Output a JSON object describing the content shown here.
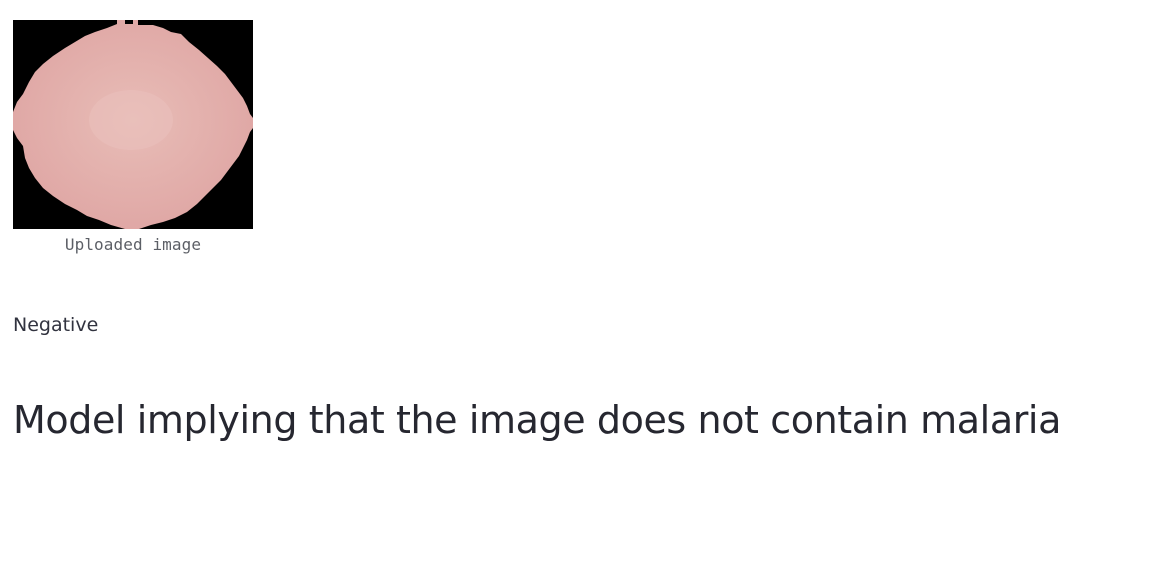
{
  "uploaded_image": {
    "caption": "Uploaded image",
    "background_color": "#000000",
    "cell_color": "#dfa6a4",
    "cell_highlight_color": "#e8bdb7"
  },
  "result": {
    "label": "Negative",
    "message": "Model implying that the image does not contain malaria"
  }
}
